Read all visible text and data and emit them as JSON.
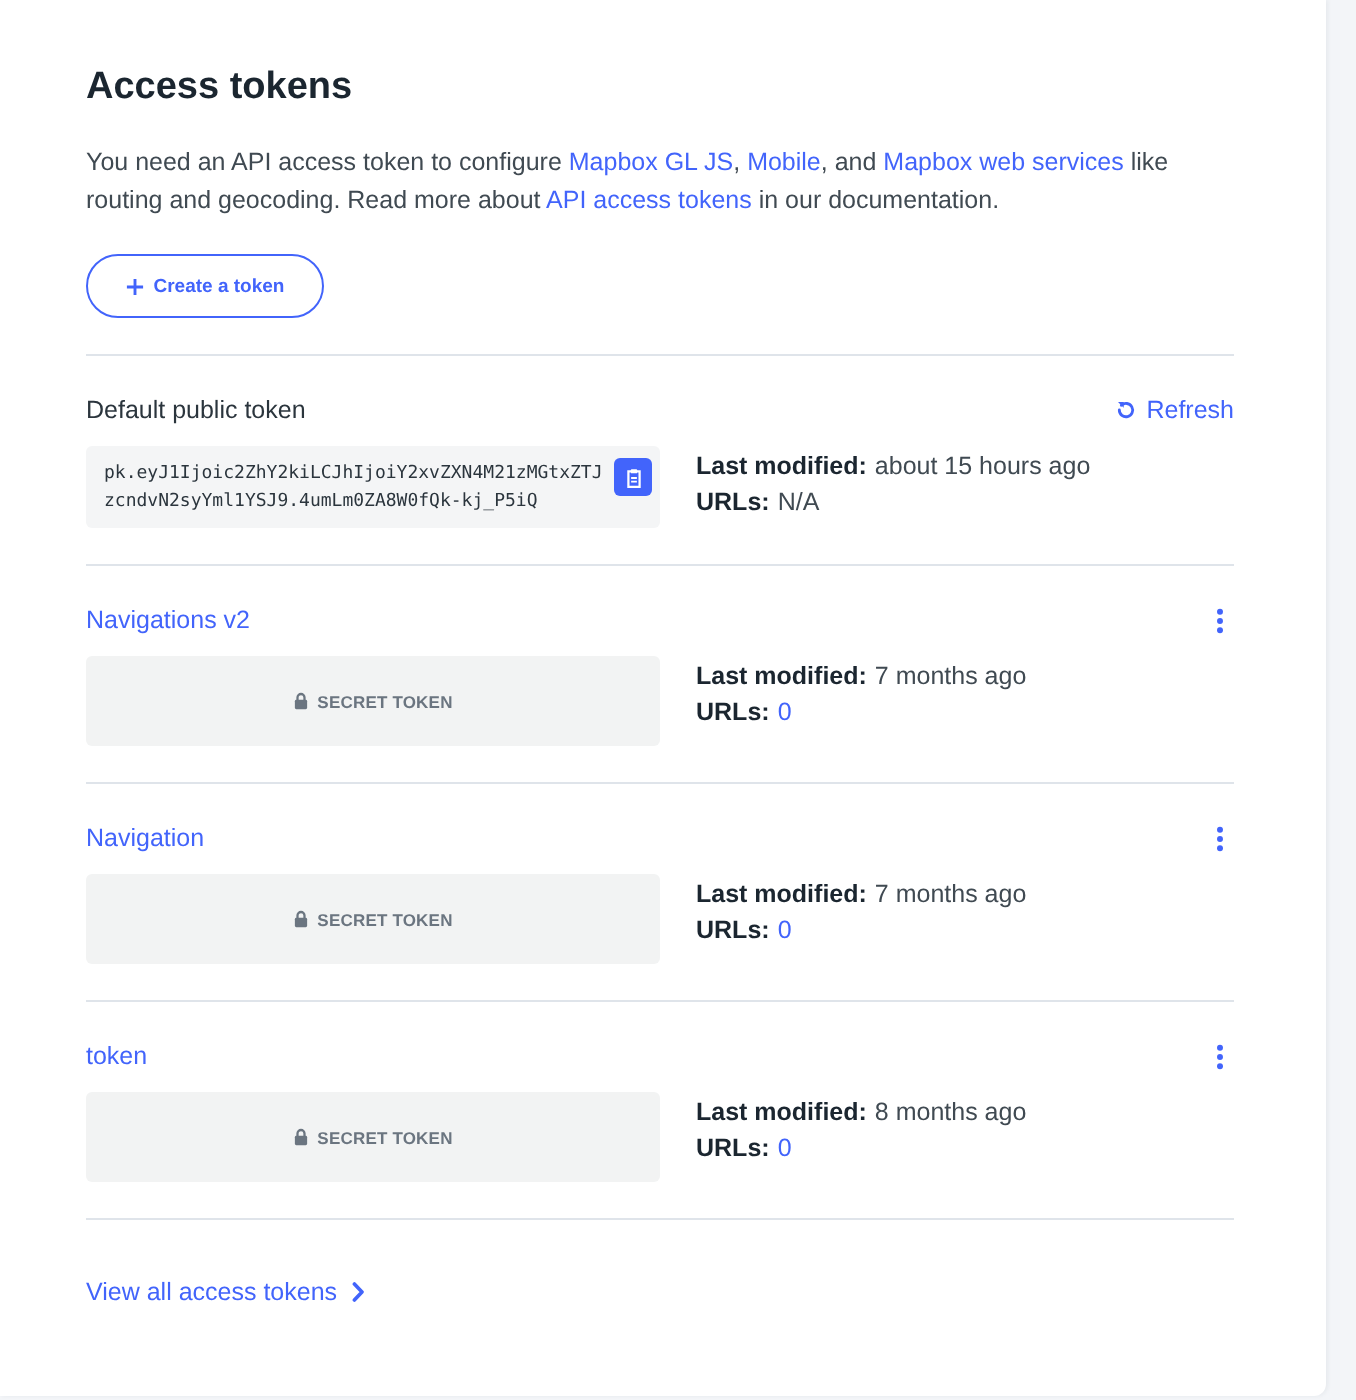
{
  "header": {
    "title": "Access tokens",
    "intro": [
      {
        "kind": "text",
        "text": "You need an API access token to configure "
      },
      {
        "kind": "link",
        "text": "Mapbox GL JS"
      },
      {
        "kind": "text",
        "text": ", "
      },
      {
        "kind": "link",
        "text": "Mobile"
      },
      {
        "kind": "text",
        "text": ", and "
      },
      {
        "kind": "link",
        "text": "Mapbox web services"
      },
      {
        "kind": "text",
        "text": " like routing and geocoding. Read more about "
      },
      {
        "kind": "link",
        "text": "API access tokens"
      },
      {
        "kind": "text",
        "text": " in our documentation."
      }
    ]
  },
  "create_button": {
    "label": "Create a token"
  },
  "default_token": {
    "label": "Default public token",
    "refresh": "Refresh",
    "token": "pk.eyJ1Ijoic2ZhY2kiLCJhIjoiY2xvZXN4M21zMGtxZTJzcndvN2syYml1YSJ9.4umLm0ZA8W0fQk-kj_P5iQ",
    "modified_label": "Last modified:",
    "modified": "about 15 hours ago",
    "urls_label": "URLs:",
    "urls": "N/A",
    "urls_linked": false
  },
  "tokens": [
    {
      "name": "Navigations v2",
      "secret_label": "SECRET TOKEN",
      "modified_label": "Last modified:",
      "modified": "7 months ago",
      "urls_label": "URLs:",
      "urls": "0",
      "urls_linked": true
    },
    {
      "name": "Navigation",
      "secret_label": "SECRET TOKEN",
      "modified_label": "Last modified:",
      "modified": "7 months ago",
      "urls_label": "URLs:",
      "urls": "0",
      "urls_linked": true
    },
    {
      "name": "token",
      "secret_label": "SECRET TOKEN",
      "modified_label": "Last modified:",
      "modified": "8 months ago",
      "urls_label": "URLs:",
      "urls": "0",
      "urls_linked": true
    }
  ],
  "view_all": {
    "label": "View all access tokens"
  }
}
